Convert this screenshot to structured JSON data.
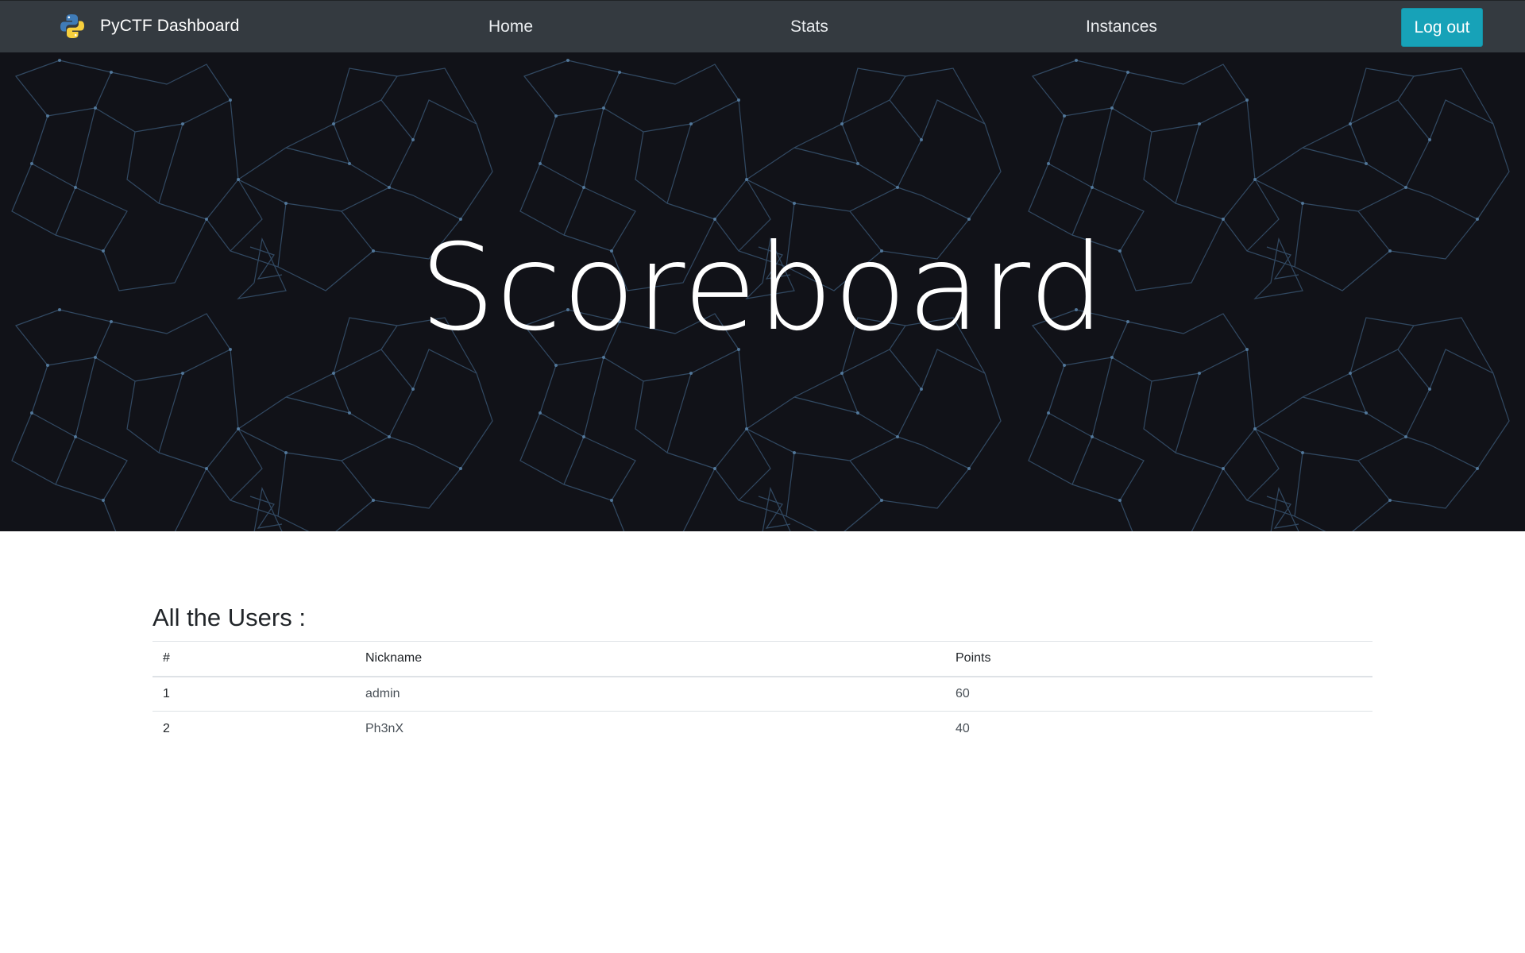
{
  "navbar": {
    "brand": "PyCTF Dashboard",
    "brand_icon": "python-logo-icon",
    "links": [
      "Home",
      "Stats",
      "Instances"
    ],
    "logout_label": "Log out",
    "bg_color": "#343a40",
    "logout_color": "#17a2b8"
  },
  "hero": {
    "title": "Scoreboard",
    "bg_color": "#111218",
    "pattern_color": "#3b5a7a"
  },
  "users": {
    "heading": "All the Users :",
    "columns": [
      "#",
      "Nickname",
      "Points"
    ],
    "rows": [
      {
        "rank": "1",
        "nickname": "admin",
        "points": "60"
      },
      {
        "rank": "2",
        "nickname": "Ph3nX",
        "points": "40"
      }
    ]
  }
}
